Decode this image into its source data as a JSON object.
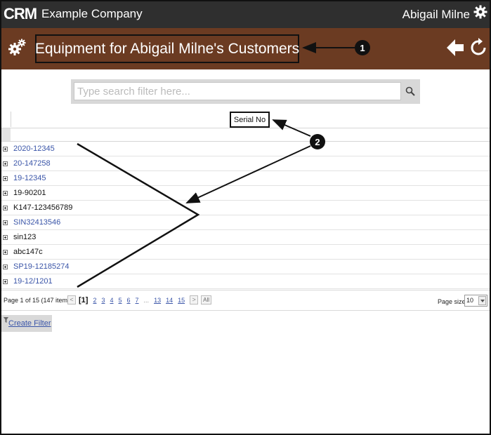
{
  "app": {
    "logo_text": "CRM",
    "company": "Example Company",
    "user": "Abigail Milne"
  },
  "header": {
    "title": "Equipment for Abigail Milne's Customers"
  },
  "search": {
    "placeholder": "Type search filter here..."
  },
  "grid": {
    "column_header": "Serial No",
    "rows": [
      {
        "serial": "2020-12345",
        "style": "link"
      },
      {
        "serial": "20-147258",
        "style": "link"
      },
      {
        "serial": "19-12345",
        "style": "link"
      },
      {
        "serial": "19-90201",
        "style": "plain"
      },
      {
        "serial": "K147-123456789",
        "style": "plain"
      },
      {
        "serial": "SIN32413546",
        "style": "link"
      },
      {
        "serial": "sin123",
        "style": "plain"
      },
      {
        "serial": "abc147c",
        "style": "plain"
      },
      {
        "serial": "SP19-12185274",
        "style": "link"
      },
      {
        "serial": "19-12/1201",
        "style": "link"
      }
    ]
  },
  "pager": {
    "info": "Page 1 of 15 (147 items)",
    "prev": "<",
    "current": "[1]",
    "pages": [
      "2",
      "3",
      "4",
      "5",
      "6",
      "7"
    ],
    "ellipsis": "...",
    "tail_pages": [
      "13",
      "14",
      "15"
    ],
    "next": ">",
    "all": "All",
    "page_size_label": "Page size:",
    "page_size": "10"
  },
  "filter": {
    "create_label": "Create Filter"
  },
  "annotations": {
    "badge_1": "1",
    "badge_2": "2"
  },
  "colors": {
    "topbar": "#2f2f2f",
    "header": "#6b3b22",
    "link": "#3a55a8"
  },
  "icons": {
    "top_right": "gear-icon",
    "header_left": "gears-icon",
    "header_back": "back-arrow-icon",
    "header_refresh": "refresh-icon",
    "search": "search-icon"
  }
}
